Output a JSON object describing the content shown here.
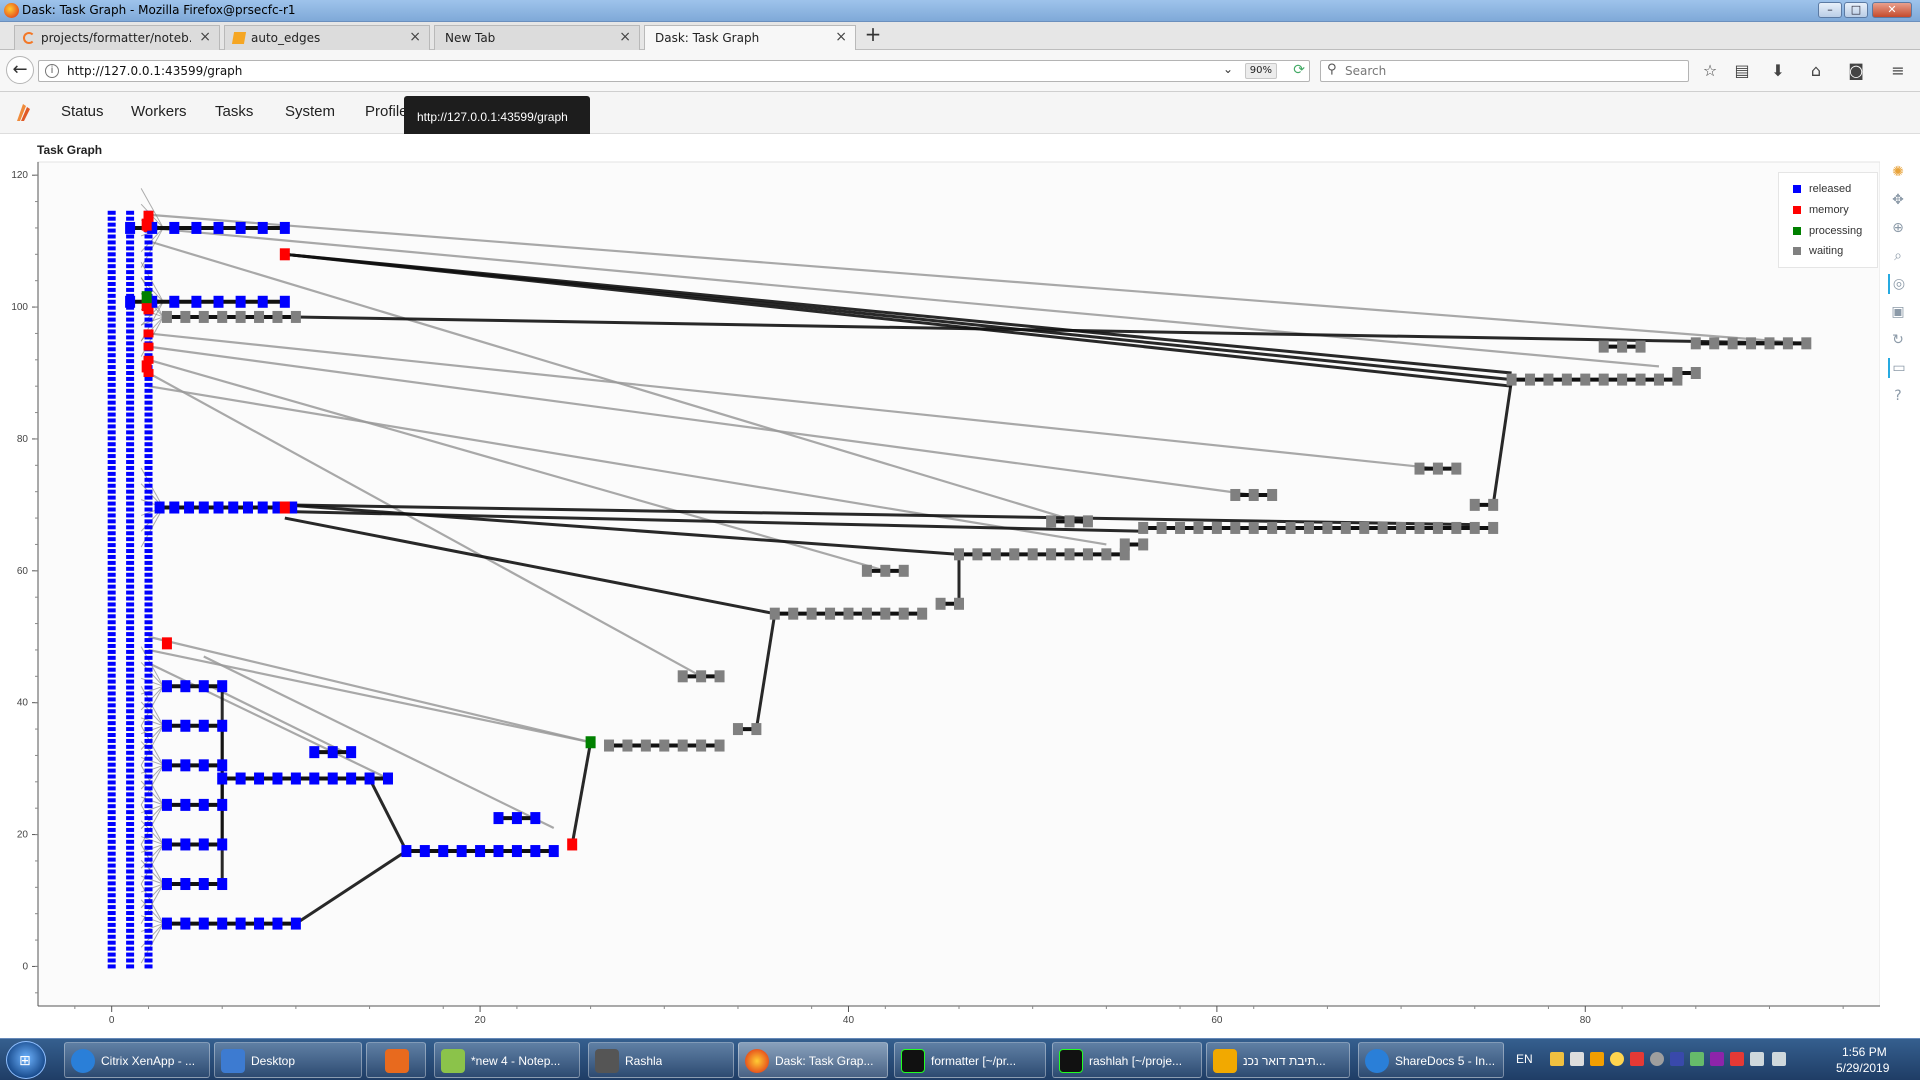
{
  "window": {
    "title": "Dask: Task Graph - Mozilla Firefox@prsecfc-r1"
  },
  "tabs": [
    {
      "label": "projects/formatter/noteb...",
      "icon": "jupyter-icon"
    },
    {
      "label": "auto_edges",
      "icon": "notebook-icon"
    },
    {
      "label": "New Tab",
      "icon": ""
    },
    {
      "label": "Dask: Task Graph",
      "icon": ""
    }
  ],
  "navbar": {
    "url": "http://127.0.0.1:43599/graph",
    "zoom": "90%",
    "search_placeholder": "Search"
  },
  "dask_nav": {
    "links": [
      "Status",
      "Workers",
      "Tasks",
      "System",
      "Profile"
    ],
    "tooltip": "http://127.0.0.1:43599/graph"
  },
  "plot": {
    "title": "Task Graph"
  },
  "legend": [
    {
      "label": "released",
      "color": "#0000ff"
    },
    {
      "label": "memory",
      "color": "#ff0000"
    },
    {
      "label": "processing",
      "color": "#008000"
    },
    {
      "label": "waiting",
      "color": "#808080"
    }
  ],
  "colors": {
    "released": "#0000ff",
    "memory": "#ff0000",
    "processing": "#008000",
    "waiting": "#808080"
  },
  "chart_data": {
    "type": "scatter",
    "title": "Task Graph",
    "x_ticks": [
      "0",
      "20",
      "40",
      "60",
      "80"
    ],
    "y_ticks": [
      "0",
      "20",
      "40",
      "60",
      "80",
      "100",
      "120"
    ],
    "xlim": [
      -4,
      96
    ],
    "ylim": [
      -6,
      122
    ],
    "legend_placement": "top-right",
    "grid": false,
    "node_groups": [
      {
        "state": "released",
        "y": 112,
        "x": [
          1,
          2.2,
          3.4,
          4.6,
          5.8,
          7,
          8.2,
          9.4
        ]
      },
      {
        "state": "released",
        "y": 100.8,
        "x": [
          1,
          2.2,
          3.4,
          4.6,
          5.8,
          7,
          8.2,
          9.4
        ]
      },
      {
        "state": "released",
        "y": 69.6,
        "x": [
          2.6,
          3.4,
          4.2,
          5,
          5.8,
          6.6,
          7.4,
          8.2,
          9,
          9.8
        ]
      },
      {
        "state": "released",
        "y": 42.5,
        "x": [
          3,
          4,
          5,
          6
        ]
      },
      {
        "state": "released",
        "y": 36.5,
        "x": [
          3,
          4,
          5,
          6
        ]
      },
      {
        "state": "released",
        "y": 30.5,
        "x": [
          3,
          4,
          5,
          6
        ]
      },
      {
        "state": "released",
        "y": 24.5,
        "x": [
          3,
          4,
          5,
          6
        ]
      },
      {
        "state": "released",
        "y": 18.5,
        "x": [
          3,
          4,
          5,
          6
        ]
      },
      {
        "state": "released",
        "y": 12.5,
        "x": [
          3,
          4,
          5,
          6
        ]
      },
      {
        "state": "released",
        "y": 6.5,
        "x": [
          3,
          4,
          5,
          6,
          7,
          8,
          9,
          10
        ]
      },
      {
        "state": "released",
        "y": 28.5,
        "x": [
          6,
          7,
          8,
          9,
          10,
          11,
          12,
          13,
          14,
          15
        ]
      },
      {
        "state": "released",
        "y": 32.5,
        "x": [
          11,
          12,
          13
        ]
      },
      {
        "state": "released",
        "y": 17.5,
        "x": [
          16,
          17,
          18,
          19,
          20,
          21,
          22,
          23,
          24
        ]
      },
      {
        "state": "released",
        "y": 22.5,
        "x": [
          21,
          22,
          23
        ]
      },
      {
        "state": "memory",
        "y": 112.5,
        "x": [
          1.9
        ]
      },
      {
        "state": "memory",
        "y": 108,
        "x": [
          9.4
        ]
      },
      {
        "state": "memory",
        "y": 100.3,
        "x": [
          1.9
        ]
      },
      {
        "state": "memory",
        "y": 91,
        "x": [
          1.9
        ]
      },
      {
        "state": "memory",
        "y": 69.6,
        "x": [
          9.4
        ]
      },
      {
        "state": "memory",
        "y": 49,
        "x": [
          3
        ]
      },
      {
        "state": "memory",
        "y": 18.5,
        "x": [
          25
        ]
      },
      {
        "state": "processing",
        "y": 34,
        "x": [
          26
        ]
      },
      {
        "state": "processing",
        "y": 101.5,
        "x": [
          1.9
        ]
      },
      {
        "state": "waiting",
        "y": 98.5,
        "x": [
          3,
          4,
          5,
          6,
          7,
          8,
          9,
          10
        ]
      },
      {
        "state": "waiting",
        "y": 33.5,
        "x": [
          27,
          28,
          29,
          30,
          31,
          32,
          33
        ]
      },
      {
        "state": "waiting",
        "y": 44,
        "x": [
          31,
          32,
          33
        ]
      },
      {
        "state": "waiting",
        "y": 36,
        "x": [
          34,
          35
        ]
      },
      {
        "state": "waiting",
        "y": 53.5,
        "x": [
          36,
          37,
          38,
          39,
          40,
          41,
          42,
          43,
          44
        ]
      },
      {
        "state": "waiting",
        "y": 60,
        "x": [
          41,
          42,
          43
        ]
      },
      {
        "state": "waiting",
        "y": 55,
        "x": [
          45,
          46
        ]
      },
      {
        "state": "waiting",
        "y": 62.5,
        "x": [
          46,
          47,
          48,
          49,
          50,
          51,
          52,
          53,
          54,
          55
        ]
      },
      {
        "state": "waiting",
        "y": 67.5,
        "x": [
          51,
          52,
          53
        ]
      },
      {
        "state": "waiting",
        "y": 64,
        "x": [
          55,
          56
        ]
      },
      {
        "state": "waiting",
        "y": 66.5,
        "x": [
          56,
          57,
          58,
          59,
          60,
          61,
          62,
          63,
          64,
          65,
          66,
          67,
          68,
          69,
          70,
          71,
          72,
          73,
          74,
          75
        ]
      },
      {
        "state": "waiting",
        "y": 71.5,
        "x": [
          61,
          62,
          63
        ]
      },
      {
        "state": "waiting",
        "y": 75.5,
        "x": [
          71,
          72,
          73
        ]
      },
      {
        "state": "waiting",
        "y": 70,
        "x": [
          74,
          75
        ]
      },
      {
        "state": "waiting",
        "y": 89,
        "x": [
          76,
          77,
          78,
          79,
          80,
          81,
          82,
          83,
          84,
          85
        ]
      },
      {
        "state": "waiting",
        "y": 94,
        "x": [
          81,
          82,
          83
        ]
      },
      {
        "state": "waiting",
        "y": 90,
        "x": [
          85,
          86
        ]
      },
      {
        "state": "waiting",
        "y": 94.5,
        "x": [
          86,
          87,
          88,
          89,
          90,
          91,
          92
        ]
      }
    ],
    "edges": [
      {
        "style": "gray",
        "from": [
          2,
          114
        ],
        "to": [
          92,
          94.5
        ]
      },
      {
        "style": "gray",
        "from": [
          2,
          112
        ],
        "to": [
          84,
          91
        ]
      },
      {
        "style": "gray",
        "from": [
          2,
          110
        ],
        "to": [
          53,
          67
        ]
      },
      {
        "style": "gray",
        "from": [
          2,
          96
        ],
        "to": [
          72,
          75.5
        ]
      },
      {
        "style": "gray",
        "from": [
          2,
          94
        ],
        "to": [
          62,
          71.5
        ]
      },
      {
        "style": "gray",
        "from": [
          2,
          92
        ],
        "to": [
          42,
          60
        ]
      },
      {
        "style": "gray",
        "from": [
          2,
          90
        ],
        "to": [
          32,
          44
        ]
      },
      {
        "style": "gray",
        "from": [
          2,
          88
        ],
        "to": [
          54,
          64
        ]
      },
      {
        "style": "gray",
        "from": [
          2,
          50
        ],
        "to": [
          26,
          34
        ]
      },
      {
        "style": "gray",
        "from": [
          2,
          48
        ],
        "to": [
          26,
          34
        ]
      },
      {
        "style": "gray",
        "from": [
          2,
          46
        ],
        "to": [
          15,
          28.5
        ]
      },
      {
        "style": "gray",
        "from": [
          5,
          47
        ],
        "to": [
          24,
          21
        ]
      },
      {
        "style": "gray",
        "from": [
          5,
          43
        ],
        "to": [
          13,
          32
        ]
      },
      {
        "style": "black",
        "from": [
          9.4,
          108
        ],
        "to": [
          76,
          89
        ]
      },
      {
        "style": "black",
        "from": [
          9.4,
          108
        ],
        "to": [
          76,
          90
        ]
      },
      {
        "style": "black",
        "from": [
          9.4,
          108
        ],
        "to": [
          76,
          88
        ]
      },
      {
        "style": "black",
        "from": [
          10,
          98.5
        ],
        "to": [
          92,
          94.5
        ]
      },
      {
        "style": "black",
        "from": [
          9.4,
          70
        ],
        "to": [
          74,
          67
        ]
      },
      {
        "style": "black",
        "from": [
          9.4,
          69
        ],
        "to": [
          56,
          66
        ]
      },
      {
        "style": "black",
        "from": [
          9.4,
          70
        ],
        "to": [
          46,
          62.5
        ]
      },
      {
        "style": "black",
        "from": [
          9.4,
          68
        ],
        "to": [
          36,
          53.5
        ]
      },
      {
        "style": "black",
        "from": [
          10,
          6.5
        ],
        "to": [
          16,
          17.5
        ]
      },
      {
        "style": "black",
        "from": [
          14,
          28.5
        ],
        "to": [
          16,
          17.5
        ]
      },
      {
        "style": "black",
        "from": [
          25,
          18.5
        ],
        "to": [
          26,
          34
        ]
      },
      {
        "style": "black",
        "from": [
          35,
          36
        ],
        "to": [
          36,
          53.5
        ]
      },
      {
        "style": "black",
        "from": [
          46,
          55
        ],
        "to": [
          46,
          62.5
        ]
      },
      {
        "style": "black",
        "from": [
          75,
          70
        ],
        "to": [
          76,
          89
        ]
      },
      {
        "style": "black",
        "from": [
          6,
          42.5
        ],
        "to": [
          6,
          28.5
        ]
      },
      {
        "style": "black",
        "from": [
          6,
          24.5
        ],
        "to": [
          6,
          28.5
        ]
      },
      {
        "style": "black",
        "from": [
          6,
          18.5
        ],
        "to": [
          6,
          28.5
        ]
      },
      {
        "style": "black",
        "from": [
          6,
          12.5
        ],
        "to": [
          6,
          28.5
        ]
      },
      {
        "style": "black",
        "from": [
          6,
          36.5
        ],
        "to": [
          6,
          28.5
        ]
      }
    ]
  },
  "taskbar": {
    "items": [
      {
        "label": "Citrix XenApp - ...",
        "icon": "ie-icon"
      },
      {
        "label": "Desktop",
        "icon": "desktop-icon"
      },
      {
        "label": "",
        "icon": "media-player-icon"
      },
      {
        "label": "*new 4 - Notep...",
        "icon": "notepad-icon"
      },
      {
        "label": "Rashla",
        "icon": "rashla-icon"
      },
      {
        "label": "Dask: Task Grap...",
        "icon": "firefox-icon"
      },
      {
        "label": "formatter [~/pr...",
        "icon": "pycharm-icon"
      },
      {
        "label": "rashlah [~/proje...",
        "icon": "pycharm-icon"
      },
      {
        "label": "תיבת דואר נכנ...",
        "icon": "outlook-icon"
      },
      {
        "label": "ShareDocs 5 - In...",
        "icon": "ie-icon"
      }
    ],
    "lang": "EN",
    "time": "1:56 PM",
    "date": "5/29/2019"
  }
}
